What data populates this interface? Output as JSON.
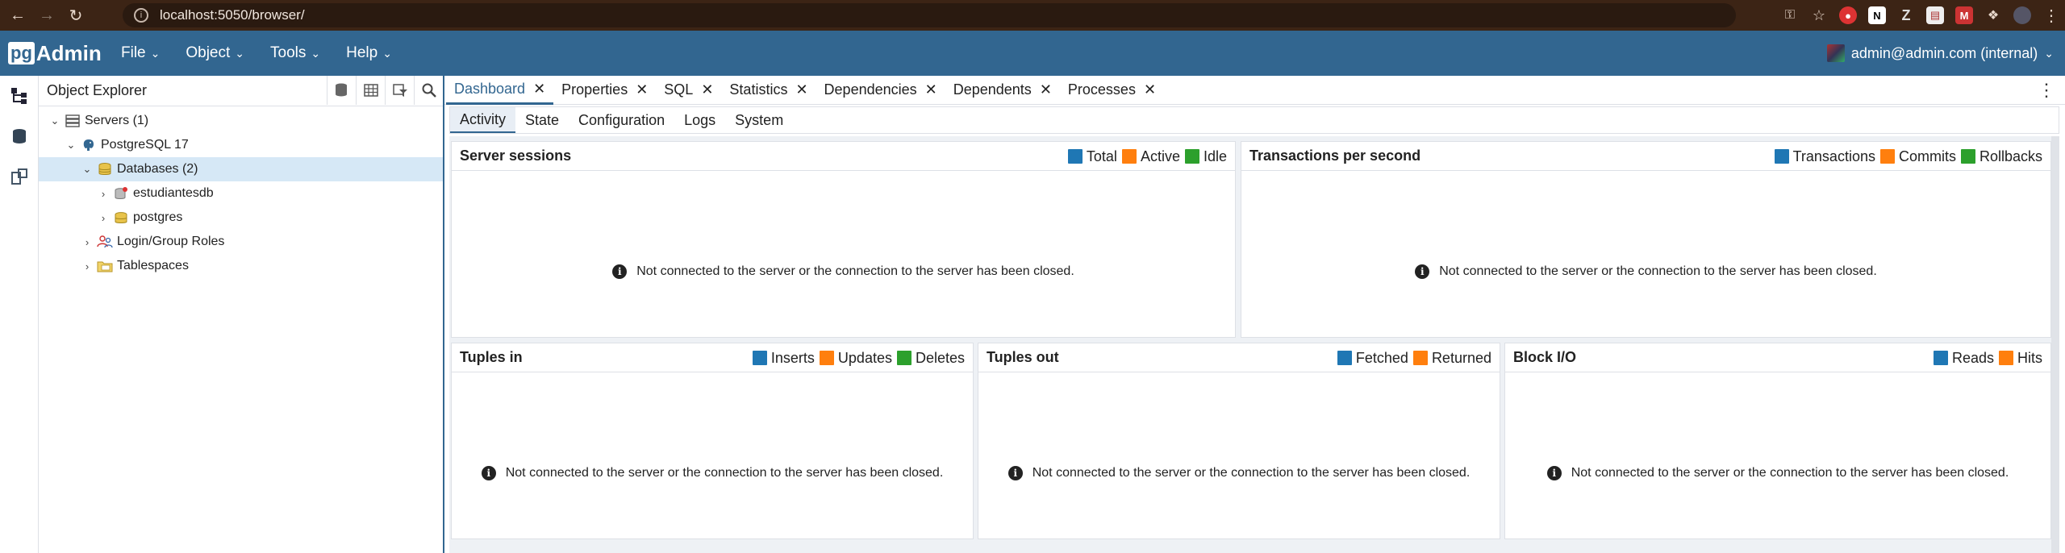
{
  "browser": {
    "url": "localhost:5050/browser/"
  },
  "app": {
    "logo_pg": "pg",
    "logo_admin": "Admin",
    "menus": [
      "File",
      "Object",
      "Tools",
      "Help"
    ],
    "user": "admin@admin.com (internal)"
  },
  "explorer": {
    "title": "Object Explorer",
    "tree": [
      {
        "label": "Servers",
        "count": "(1)"
      },
      {
        "label": "PostgreSQL 17",
        "count": ""
      },
      {
        "label": "Databases",
        "count": "(2)"
      },
      {
        "label": "estudiantesdb",
        "count": ""
      },
      {
        "label": "postgres",
        "count": ""
      },
      {
        "label": "Login/Group Roles",
        "count": ""
      },
      {
        "label": "Tablespaces",
        "count": ""
      }
    ]
  },
  "tabs": [
    "Dashboard",
    "Properties",
    "SQL",
    "Statistics",
    "Dependencies",
    "Dependents",
    "Processes"
  ],
  "subtabs": [
    "Activity",
    "State",
    "Configuration",
    "Logs",
    "System"
  ],
  "message": "Not connected to the server or the connection to the server has been closed.",
  "cards": {
    "sessions": {
      "title": "Server sessions",
      "legend": [
        "Total",
        "Active",
        "Idle"
      ]
    },
    "tps": {
      "title": "Transactions per second",
      "legend": [
        "Transactions",
        "Commits",
        "Rollbacks"
      ]
    },
    "tuples_in": {
      "title": "Tuples in",
      "legend": [
        "Inserts",
        "Updates",
        "Deletes"
      ]
    },
    "tuples_out": {
      "title": "Tuples out",
      "legend": [
        "Fetched",
        "Returned"
      ]
    },
    "block_io": {
      "title": "Block I/O",
      "legend": [
        "Reads",
        "Hits"
      ]
    }
  },
  "colors": {
    "blue": "#1f77b4",
    "orange": "#ff7f0e",
    "green": "#2ca02c",
    "header": "#326690"
  }
}
